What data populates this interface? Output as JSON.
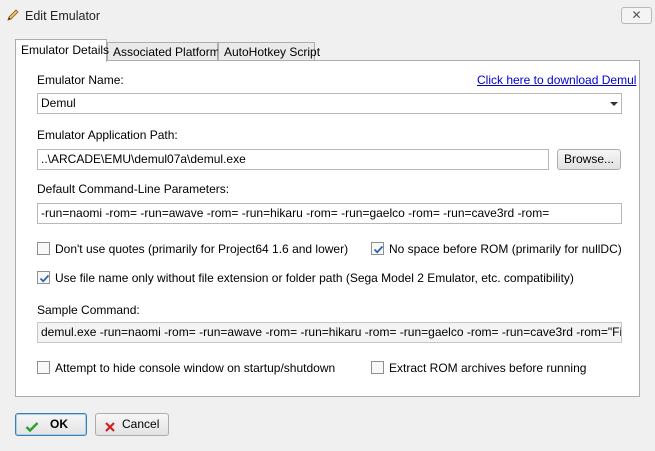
{
  "window": {
    "title": "Edit Emulator",
    "close_glyph": "✕"
  },
  "tabs": [
    {
      "label": "Emulator Details",
      "active": true
    },
    {
      "label": "Associated Platforms",
      "active": false
    },
    {
      "label": "AutoHotkey Script",
      "active": false
    }
  ],
  "form": {
    "name_label": "Emulator Name:",
    "download_link": "Click here to download Demul",
    "name_value": "Demul",
    "path_label": "Emulator Application Path:",
    "path_value": "..\\ARCADE\\EMU\\demul07a\\demul.exe",
    "browse_label": "Browse...",
    "params_label": "Default Command-Line Parameters:",
    "params_value": "-run=naomi -rom= -run=awave -rom= -run=hikaru -rom= -run=gaelco -rom= -run=cave3rd -rom=",
    "no_quotes_label": "Don't use quotes (primarily for Project64 1.6 and lower)",
    "no_quotes_checked": false,
    "no_space_label": "No space before ROM (primarily for nullDC)",
    "no_space_checked": true,
    "filename_only_label": "Use file name only without file extension or folder path (Sega Model 2 Emulator, etc. compatibility)",
    "filename_only_checked": true,
    "sample_label": "Sample Command:",
    "sample_value": "demul.exe -run=naomi -rom= -run=awave -rom= -run=hikaru -rom= -run=gaelco -rom= -run=cave3rd -rom=\"File\"",
    "hide_console_label": "Attempt to hide console window on startup/shutdown",
    "hide_console_checked": false,
    "extract_rom_label": "Extract ROM archives before running",
    "extract_rom_checked": false
  },
  "footer": {
    "ok_label": "OK",
    "cancel_label": "Cancel"
  },
  "colors": {
    "link": "#0000cc",
    "check": "#2a64b0",
    "ok_icon": "#2e9e2e",
    "cancel_icon": "#cc2222"
  },
  "icons": [
    "pencil-icon",
    "close-icon",
    "chevron-down-icon",
    "checkmark-icon",
    "cross-icon"
  ]
}
